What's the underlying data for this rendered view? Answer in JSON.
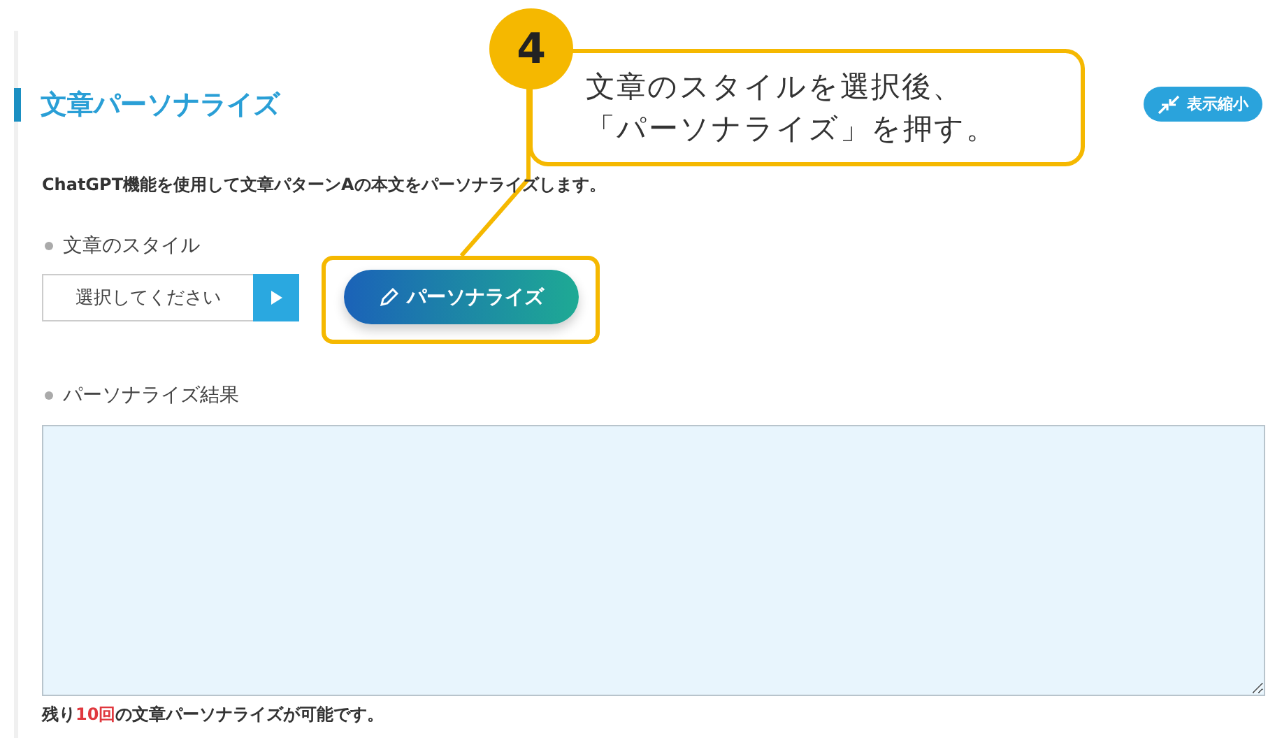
{
  "section": {
    "title": "文章パーソナライズ",
    "collapse_button": "表示縮小",
    "description": "ChatGPT機能を使用して文章パターンAの本文をパーソナライズします。",
    "style_field": {
      "label": "文章のスタイル",
      "placeholder": "選択してください"
    },
    "personalize_button": "パーソナライズ",
    "result_field": {
      "label": "パーソナライズ結果"
    },
    "remaining": {
      "prefix": "残り",
      "count": "10回",
      "suffix": "の文章パーソナライズが可能です。"
    }
  },
  "annotation": {
    "step": "4",
    "lines": [
      "文章のスタイルを選択後、",
      "「パーソナライズ」を押す。"
    ]
  }
}
